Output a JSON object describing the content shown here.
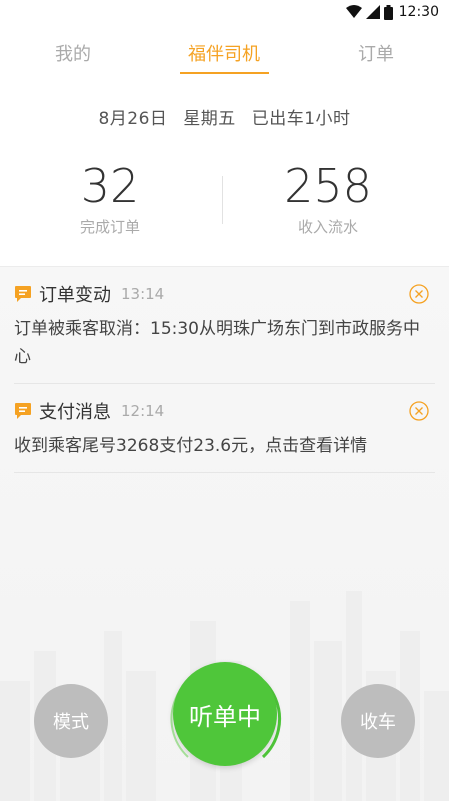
{
  "status_bar": {
    "time": "12:30"
  },
  "tabs": [
    {
      "label": "我的"
    },
    {
      "label": "福伴司机"
    },
    {
      "label": "订单"
    }
  ],
  "header": {
    "date": "8月26日",
    "weekday": "星期五",
    "duration": "已出车1小时"
  },
  "stats": [
    {
      "value": "32",
      "label": "完成订单"
    },
    {
      "value": "258",
      "label": "收入流水"
    }
  ],
  "messages": [
    {
      "title": "订单变动",
      "time": "13:14",
      "body": "订单被乘客取消：15:30从明珠广场东门到市政服务中心",
      "icon": "chat-bubble-icon"
    },
    {
      "title": "支付消息",
      "time": "12:14",
      "body": "收到乘客尾号3268支付23.6元，点击查看详情",
      "icon": "chat-bubble-icon"
    }
  ],
  "buttons": {
    "mode": "模式",
    "listening": "听单中",
    "stop": "收车"
  },
  "colors": {
    "accent": "#f5a223",
    "listening_green": "#4fc63a",
    "side_button_gray": "#bdbdbd"
  }
}
